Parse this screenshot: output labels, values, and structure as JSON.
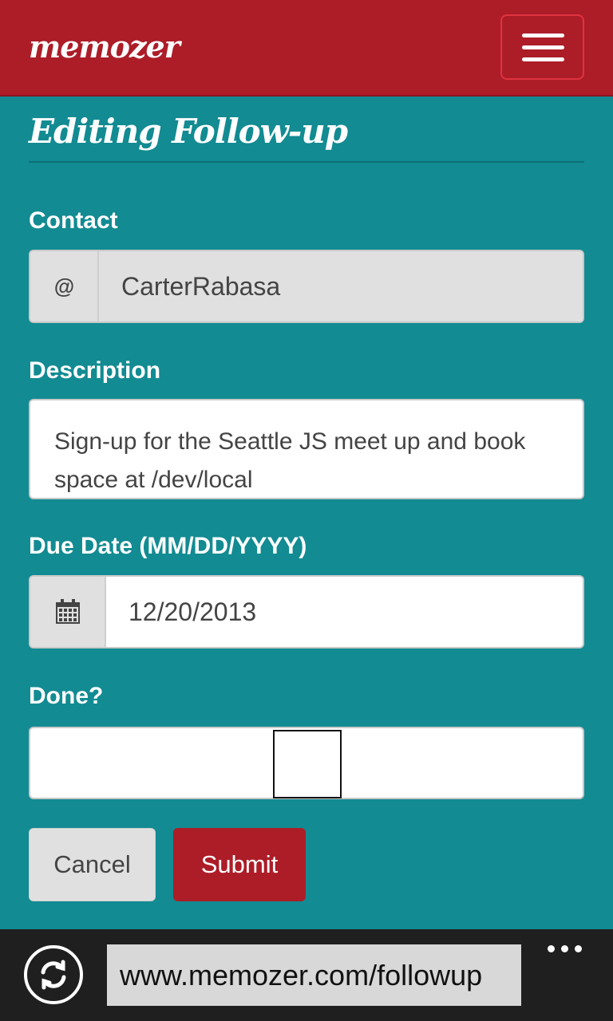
{
  "app": {
    "brand": "memozer"
  },
  "page": {
    "title": "Editing Follow-up"
  },
  "form": {
    "contact": {
      "label": "Contact",
      "prefix": "@",
      "value": "CarterRabasa"
    },
    "description": {
      "label": "Description",
      "value": "Sign-up for the Seattle JS meet up and book space at /dev/local"
    },
    "due_date": {
      "label": "Due Date (MM/DD/YYYY)",
      "icon": "calendar-icon",
      "value": "12/20/2013"
    },
    "done": {
      "label": "Done?",
      "checked": false
    }
  },
  "actions": {
    "cancel": "Cancel",
    "submit": "Submit"
  },
  "browser": {
    "url": "www.memozer.com/followup"
  },
  "colors": {
    "navbar": "#ac1d28",
    "background": "#128b92",
    "submit": "#ac1d28",
    "appbar": "#1f1f1f"
  }
}
